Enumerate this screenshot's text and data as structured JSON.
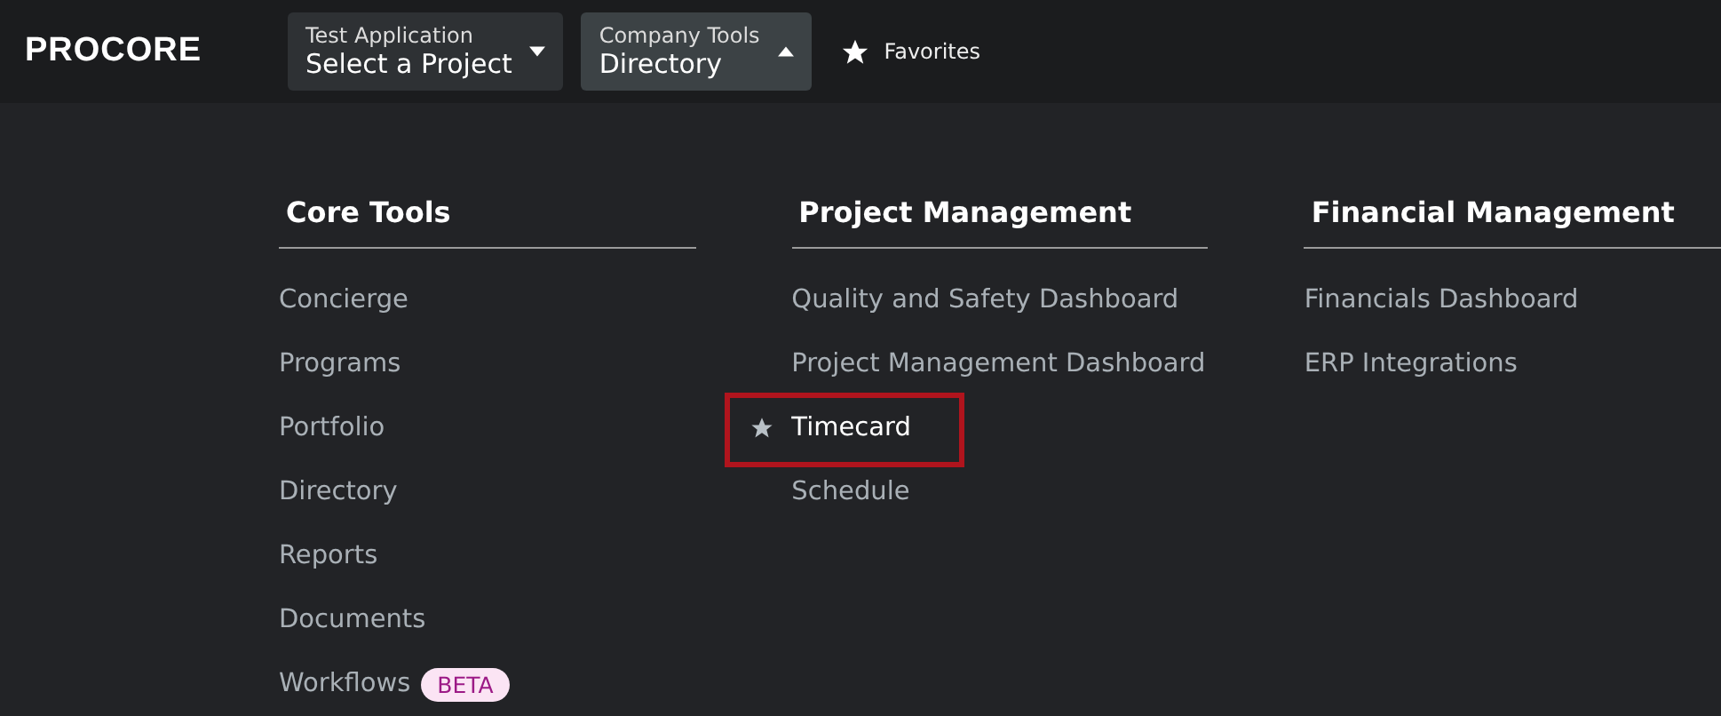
{
  "header": {
    "logo": "PROCORE",
    "selectors": [
      {
        "label": "Test Application",
        "value": "Select a Project",
        "expanded": false
      },
      {
        "label": "Company Tools",
        "value": "Directory",
        "expanded": true
      }
    ],
    "favorites": "Favorites"
  },
  "columns": [
    {
      "title": "Core Tools",
      "items": [
        {
          "label": "Concierge",
          "favorite": false,
          "highlighted": false
        },
        {
          "label": "Programs",
          "favorite": false,
          "highlighted": false
        },
        {
          "label": "Portfolio",
          "favorite": false,
          "highlighted": false
        },
        {
          "label": "Directory",
          "favorite": false,
          "highlighted": false
        },
        {
          "label": "Reports",
          "favorite": false,
          "highlighted": false
        },
        {
          "label": "Documents",
          "favorite": false,
          "highlighted": false
        },
        {
          "label": "Workflows",
          "favorite": false,
          "highlighted": false,
          "badge": "BETA"
        }
      ]
    },
    {
      "title": "Project Management",
      "items": [
        {
          "label": "Quality and Safety Dashboard",
          "favorite": false,
          "highlighted": false
        },
        {
          "label": "Project Management Dashboard",
          "favorite": false,
          "highlighted": false
        },
        {
          "label": "Timecard",
          "favorite": true,
          "highlighted": true
        },
        {
          "label": "Schedule",
          "favorite": false,
          "highlighted": false
        }
      ]
    },
    {
      "title": "Financial Management",
      "items": [
        {
          "label": "Financials Dashboard",
          "favorite": false,
          "highlighted": false
        },
        {
          "label": "ERP Integrations",
          "favorite": false,
          "highlighted": false
        }
      ]
    }
  ]
}
